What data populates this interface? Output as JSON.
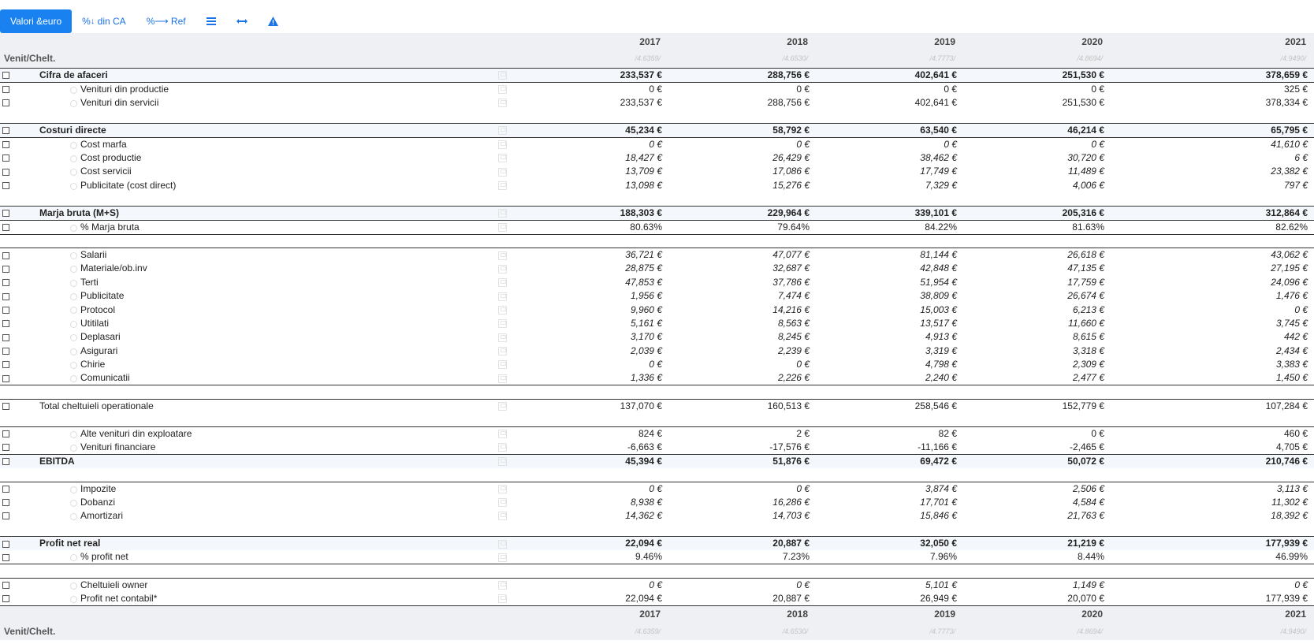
{
  "toolbar": {
    "items": [
      {
        "label": "Valori &euro",
        "icon": "",
        "active": true
      },
      {
        "label": "din CA",
        "prefix": "%",
        "icon": "arrow-down-icon"
      },
      {
        "label": "Ref",
        "prefix": "%",
        "icon": "arrow-right-icon"
      },
      {
        "label": "",
        "icon": "list-icon"
      },
      {
        "label": "",
        "icon": "horizontal-arrows-icon"
      },
      {
        "label": "",
        "icon": "warning-icon"
      }
    ]
  },
  "header": {
    "label": "Venit/Chelt.",
    "years": [
      "2017",
      "2018",
      "2019",
      "2020",
      "2021"
    ],
    "fx": [
      "/4.6359/",
      "/4.6530/",
      "/4.7773/",
      "/4.8694/",
      "/4.9490/"
    ]
  },
  "rows": [
    {
      "label": "Cifra de afaceri",
      "style": "bold",
      "values": [
        "233,537 €",
        "288,756 €",
        "402,641 €",
        "251,530 €",
        "378,659 €"
      ]
    },
    {
      "label": "Venituri din productie",
      "style": "sub",
      "values": [
        "0 €",
        "0 €",
        "0 €",
        "0 €",
        "325 €"
      ]
    },
    {
      "label": "Venituri din servicii",
      "style": "sub",
      "values": [
        "233,537 €",
        "288,756 €",
        "402,641 €",
        "251,530 €",
        "378,334 €"
      ]
    },
    {
      "label": "Costuri directe",
      "style": "bold",
      "values": [
        "45,234 €",
        "58,792 €",
        "63,540 €",
        "46,214 €",
        "65,795 €"
      ]
    },
    {
      "label": "Cost marfa",
      "style": "sub-i",
      "values": [
        "0 €",
        "0 €",
        "0 €",
        "0 €",
        "41,610 €"
      ]
    },
    {
      "label": "Cost productie",
      "style": "sub-i",
      "values": [
        "18,427 €",
        "26,429 €",
        "38,462 €",
        "30,720 €",
        "6 €"
      ]
    },
    {
      "label": "Cost servicii",
      "style": "sub-i",
      "values": [
        "13,709 €",
        "17,086 €",
        "17,749 €",
        "11,489 €",
        "23,382 €"
      ]
    },
    {
      "label": "Publicitate (cost direct)",
      "style": "sub-i",
      "values": [
        "13,098 €",
        "15,276 €",
        "7,329 €",
        "4,006 €",
        "797 €"
      ]
    },
    {
      "label": "Marja bruta (M+S)",
      "style": "bold",
      "values": [
        "188,303 €",
        "229,964 €",
        "339,101 €",
        "205,316 €",
        "312,864 €"
      ]
    },
    {
      "label": "% Marja bruta",
      "style": "sub",
      "values": [
        "80.63%",
        "79.64%",
        "84.22%",
        "81.63%",
        "82.62%"
      ]
    },
    {
      "label": "Salarii",
      "style": "sub-i",
      "values": [
        "36,721 €",
        "47,077 €",
        "81,144 €",
        "26,618 €",
        "43,062 €"
      ]
    },
    {
      "label": "Materiale/ob.inv",
      "style": "sub-i",
      "values": [
        "28,875 €",
        "32,687 €",
        "42,848 €",
        "47,135 €",
        "27,195 €"
      ]
    },
    {
      "label": "Terti",
      "style": "sub-i",
      "values": [
        "47,853 €",
        "37,786 €",
        "51,954 €",
        "17,759 €",
        "24,096 €"
      ]
    },
    {
      "label": "Publicitate",
      "style": "sub-i",
      "values": [
        "1,956 €",
        "7,474 €",
        "38,809 €",
        "26,674 €",
        "1,476 €"
      ]
    },
    {
      "label": "Protocol",
      "style": "sub-i",
      "values": [
        "9,960 €",
        "14,216 €",
        "15,003 €",
        "6,213 €",
        "0 €"
      ]
    },
    {
      "label": "Utitilati",
      "style": "sub-i",
      "values": [
        "5,161 €",
        "8,563 €",
        "13,517 €",
        "11,660 €",
        "3,745 €"
      ]
    },
    {
      "label": "Deplasari",
      "style": "sub-i",
      "values": [
        "3,170 €",
        "8,245 €",
        "4,913 €",
        "8,615 €",
        "442 €"
      ]
    },
    {
      "label": "Asigurari",
      "style": "sub-i",
      "values": [
        "2,039 €",
        "2,239 €",
        "3,319 €",
        "3,318 €",
        "2,434 €"
      ]
    },
    {
      "label": "Chirie",
      "style": "sub-i",
      "values": [
        "0 €",
        "0 €",
        "4,798 €",
        "2,309 €",
        "3,383 €"
      ]
    },
    {
      "label": "Comunicatii",
      "style": "sub-i",
      "values": [
        "1,336 €",
        "2,226 €",
        "2,240 €",
        "2,477 €",
        "1,450 €"
      ]
    },
    {
      "label": "Total cheltuieli operationale",
      "style": "total",
      "values": [
        "137,070 €",
        "160,513 €",
        "258,546 €",
        "152,779 €",
        "107,284 €"
      ]
    },
    {
      "label": "Alte venituri din exploatare",
      "style": "sub",
      "values": [
        "824 €",
        "2 €",
        "82 €",
        "0 €",
        "460 €"
      ]
    },
    {
      "label": "Venituri financiare",
      "style": "sub",
      "values": [
        "-6,663 €",
        "-17,576 €",
        "-11,166 €",
        "-2,465 €",
        "4,705 €"
      ]
    },
    {
      "label": "EBITDA",
      "style": "bold",
      "values": [
        "45,394 €",
        "51,876 €",
        "69,472 €",
        "50,072 €",
        "210,746 €"
      ]
    },
    {
      "label": "Impozite",
      "style": "sub-i",
      "values": [
        "0 €",
        "0 €",
        "3,874 €",
        "2,506 €",
        "3,113 €"
      ]
    },
    {
      "label": "Dobanzi",
      "style": "sub-i",
      "values": [
        "8,938 €",
        "16,286 €",
        "17,701 €",
        "4,584 €",
        "11,302 €"
      ]
    },
    {
      "label": "Amortizari",
      "style": "sub-i",
      "values": [
        "14,362 €",
        "14,703 €",
        "15,846 €",
        "21,763 €",
        "18,392 €"
      ]
    },
    {
      "label": "Profit net real",
      "style": "bold",
      "values": [
        "22,094 €",
        "20,887 €",
        "32,050 €",
        "21,219 €",
        "177,939 €"
      ]
    },
    {
      "label": "% profit net",
      "style": "sub",
      "values": [
        "9.46%",
        "7.23%",
        "7.96%",
        "8.44%",
        "46.99%"
      ]
    },
    {
      "label": "Cheltuieli owner",
      "style": "sub-i",
      "values": [
        "0 €",
        "0 €",
        "5,101 €",
        "1,149 €",
        "0 €"
      ]
    },
    {
      "label": "Profit net contabil*",
      "style": "sub",
      "values": [
        "22,094 €",
        "20,887 €",
        "26,949 €",
        "20,070 €",
        "177,939 €"
      ]
    }
  ]
}
